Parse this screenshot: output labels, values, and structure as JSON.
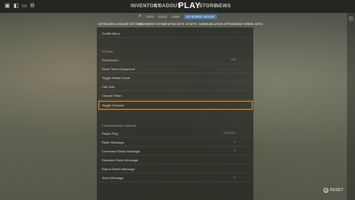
{
  "topbar": {
    "icons": [
      "home-icon",
      "loadout-icon",
      "tv-icon",
      "settings-icon"
    ],
    "nav": [
      "INVENTORY",
      "LOADOUT",
      "PLAY",
      "STORE",
      "NEWS"
    ]
  },
  "subnav": {
    "items": [
      "VIDEO",
      "AUDIO",
      "GAME",
      "KEYBOARD / MOUSE"
    ],
    "active": "KEYBOARD / MOUSE"
  },
  "tabs": [
    "KEYBOARD & MOUSE SETTINGS",
    "MOVEMENT KEYS",
    "WEAPON KEYS",
    "UI KEYS",
    "COMMUNICATION OPTIONS",
    "CHAT WHEEL KEYS"
  ],
  "rows": {
    "graffiti_menu": {
      "label": "Graffiti Menu",
      "value": "T"
    },
    "ui_keys_header": "UI Keys",
    "scoreboard": {
      "label": "Scoreboard",
      "value": "TAB"
    },
    "show_team_equipment": {
      "label": "Show Team Equipment",
      "value": ""
    },
    "toggle_radar_zoom": {
      "label": "Toggle Radar Zoom",
      "value": ""
    },
    "call_vote": {
      "label": "Call Vote",
      "value": ""
    },
    "choose_team": {
      "label": "Choose Team",
      "value": ""
    },
    "toggle_console": {
      "label": "Toggle Console",
      "value": ""
    },
    "communication_header": "Communication Options",
    "player_ping": {
      "label": "Player Ping",
      "value": "MOUSE3"
    },
    "radio_message": {
      "label": "Radio Message",
      "value": "Z"
    },
    "command_radio_message": {
      "label": "Command Radio Message",
      "value": "X"
    },
    "standard_radio_message": {
      "label": "Standard Radio Message",
      "value": ""
    },
    "report_radio_message": {
      "label": "Report Radio Message",
      "value": ""
    },
    "team_message": {
      "label": "Team Message",
      "value": "U"
    }
  },
  "reset": {
    "label": "RESET"
  },
  "colors": {
    "highlight": "#e8921e",
    "active_tab": "#4a76a8"
  }
}
